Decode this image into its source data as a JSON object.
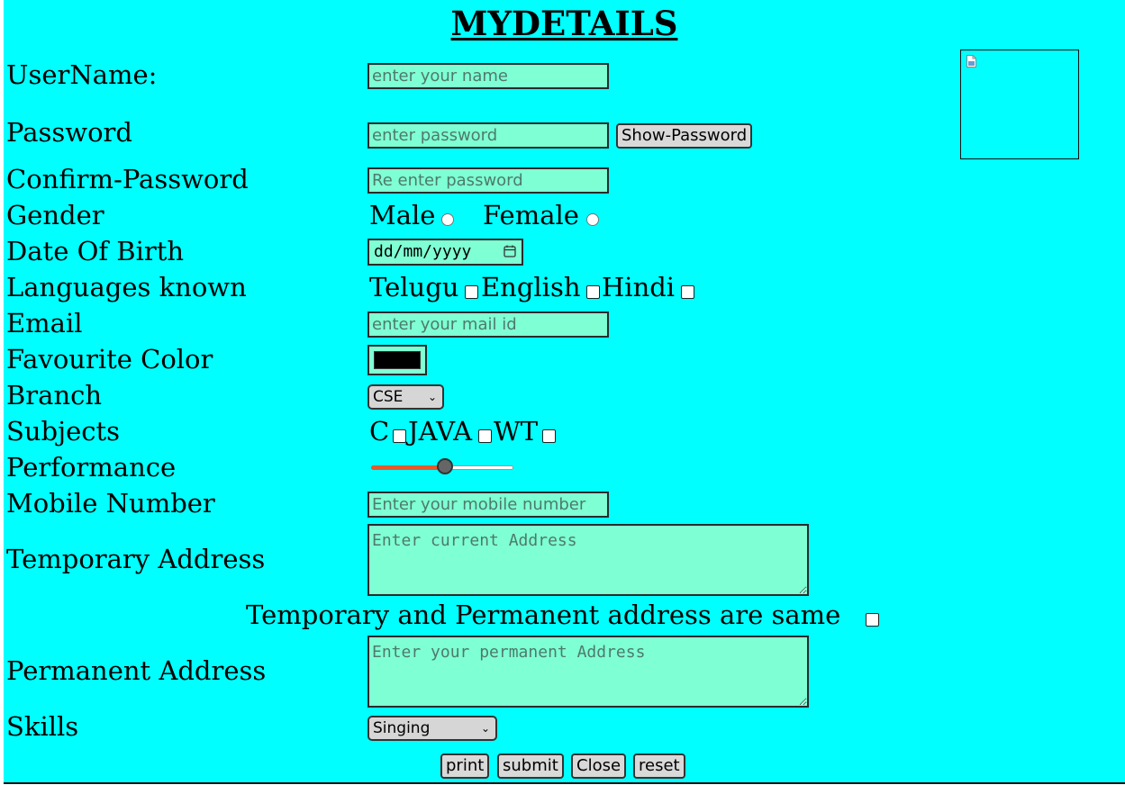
{
  "title": "MYDETAILS",
  "labels": {
    "username": "UserName:",
    "password": "Password",
    "confirm_password": "Confirm-Password",
    "gender": "Gender",
    "dob": "Date Of Birth",
    "languages": "Languages known",
    "email": "Email",
    "fav_color": "Favourite Color",
    "branch": "Branch",
    "subjects": "Subjects",
    "performance": "Performance",
    "mobile": "Mobile Number",
    "temp_address": "Temporary Address",
    "same_address": "Temporary and Permanent address are same",
    "perm_address": "Permanent Address",
    "skills": "Skills"
  },
  "placeholders": {
    "username": "enter your name",
    "password": "enter password",
    "confirm_password": "Re enter password",
    "email": "enter your mail id",
    "mobile": "Enter your mobile number",
    "temp_address": "Enter current Address",
    "perm_address": "Enter your permanent Address"
  },
  "buttons": {
    "show_password": "Show-Password",
    "print": "print",
    "submit": "submit",
    "close": "Close",
    "reset": "reset"
  },
  "gender_options": [
    "Male",
    "Female"
  ],
  "language_options": [
    "Telugu",
    "English",
    "Hindi"
  ],
  "subject_options": [
    "C",
    "JAVA",
    "WT"
  ],
  "dob_placeholder": "dd/mm/yyyy",
  "favourite_color": "#000000",
  "branch_selected": "CSE",
  "skills_selected": "Singing",
  "performance_level": 0.5,
  "colors": {
    "page_background": "#00ffff",
    "input_background": "#7fffd4",
    "slider_fill": "#e55a2b"
  },
  "icons": {
    "photo": "broken-image-icon",
    "date": "calendar-icon",
    "select": "chevron-down-icon"
  }
}
